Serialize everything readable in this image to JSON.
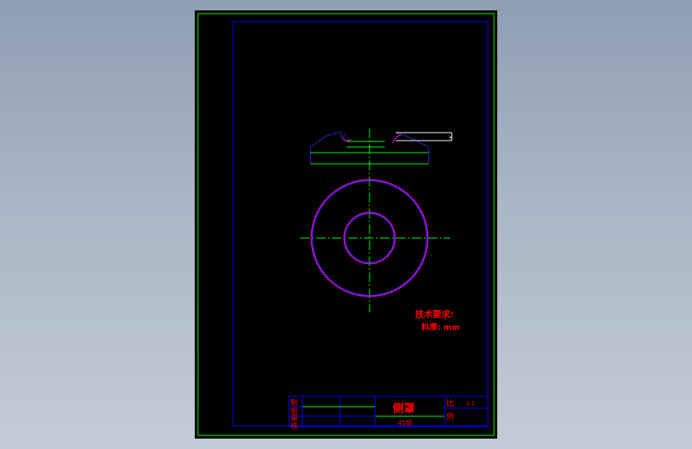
{
  "drawing": {
    "colors": {
      "background": "#000000",
      "outer_frame": "#00ff00",
      "inner_frame": "#0000ff",
      "center_line": "#00ff00",
      "outline_blue": "#3333ff",
      "outline_magenta": "#ff00ff",
      "text_red": "#ff0000"
    },
    "notes": {
      "line1": "技术要求:",
      "line2": "料厚: mm"
    },
    "title_block": {
      "part_name": "侧罩",
      "material": "45钢",
      "scale": "1.1",
      "label_bi": "比",
      "label_li": "例",
      "left_labels": [
        "制",
        "图",
        "审",
        "核"
      ]
    }
  }
}
